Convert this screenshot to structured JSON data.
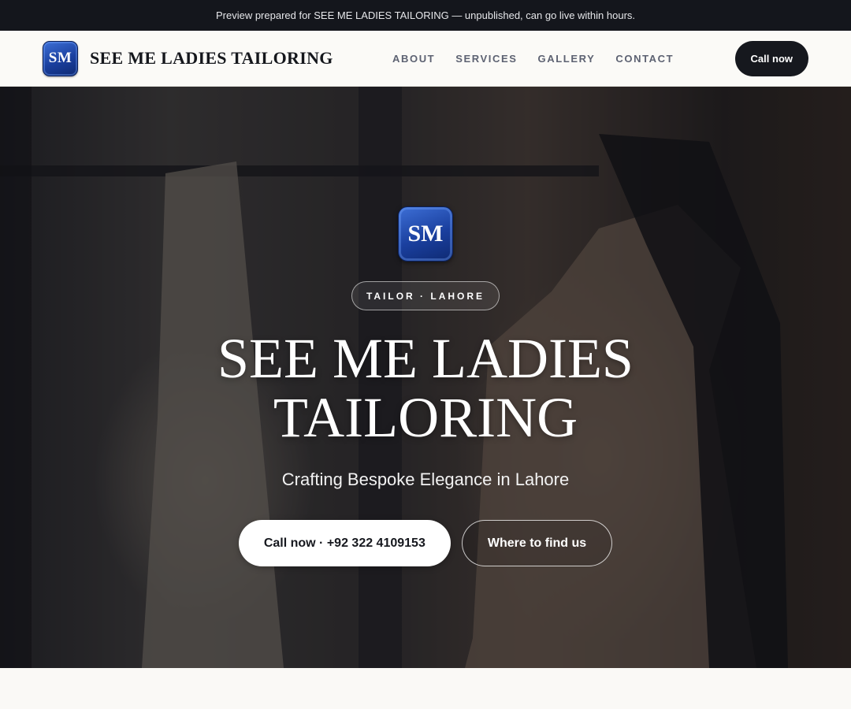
{
  "preview_bar": {
    "text": "Preview prepared for SEE ME LADIES TAILORING — unpublished, can go live within hours."
  },
  "header": {
    "logo_text": "SM",
    "brand_name": "SEE ME LADIES TAILORING",
    "nav": [
      {
        "label": "ABOUT"
      },
      {
        "label": "SERVICES"
      },
      {
        "label": "GALLERY"
      },
      {
        "label": "CONTACT"
      }
    ],
    "cta_label": "Call now"
  },
  "hero": {
    "logo_text": "SM",
    "tag": "TAILOR · LAHORE",
    "title": "SEE ME LADIES TAILORING",
    "subtitle": "Crafting Bespoke Elegance in Lahore",
    "primary_cta": "Call now · +92 322 4109153",
    "secondary_cta": "Where to find us"
  },
  "colors": {
    "dark": "#16181e",
    "logo_blue": "#1a3f9e",
    "background": "#faf9f6",
    "nav_text": "#5d6272"
  },
  "icons": [
    "sm-logo-badge"
  ]
}
